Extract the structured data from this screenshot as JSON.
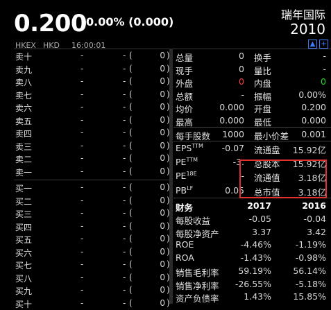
{
  "quote": {
    "price": "0.200",
    "change": "0.00% (0.000)",
    "stock_name": "瑞年国际",
    "stock_code": "2010",
    "exchange": "HKEX",
    "currency": "HKD",
    "time": "16:00:01"
  },
  "icons": {
    "flag_icon": "flag-icon",
    "add_icon": "plus-icon"
  },
  "order_book": {
    "sell": [
      {
        "label": "卖十",
        "price": "-",
        "dash": "-",
        "paren": "(",
        "qty": "0",
        "close": ")"
      },
      {
        "label": "卖九",
        "price": "-",
        "dash": "-",
        "paren": "(",
        "qty": "0",
        "close": ")"
      },
      {
        "label": "卖八",
        "price": "-",
        "dash": "-",
        "paren": "(",
        "qty": "0",
        "close": ")"
      },
      {
        "label": "卖七",
        "price": "-",
        "dash": "-",
        "paren": "(",
        "qty": "0",
        "close": ")"
      },
      {
        "label": "卖六",
        "price": "-",
        "dash": "-",
        "paren": "(",
        "qty": "0",
        "close": ")"
      },
      {
        "label": "卖五",
        "price": "-",
        "dash": "-",
        "paren": "(",
        "qty": "0",
        "close": ")"
      },
      {
        "label": "卖四",
        "price": "-",
        "dash": "-",
        "paren": "(",
        "qty": "0",
        "close": ")"
      },
      {
        "label": "卖三",
        "price": "-",
        "dash": "-",
        "paren": "(",
        "qty": "0",
        "close": ")"
      },
      {
        "label": "卖二",
        "price": "-",
        "dash": "-",
        "paren": "(",
        "qty": "0",
        "close": ")"
      },
      {
        "label": "卖一",
        "price": "-",
        "dash": "-",
        "paren": "(",
        "qty": "0",
        "close": ")"
      }
    ],
    "buy": [
      {
        "label": "买一",
        "price": "-",
        "dash": "-",
        "paren": "(",
        "qty": "0",
        "close": ")"
      },
      {
        "label": "买二",
        "price": "-",
        "dash": "-",
        "paren": "(",
        "qty": "0",
        "close": ")"
      },
      {
        "label": "买三",
        "price": "-",
        "dash": "-",
        "paren": "(",
        "qty": "0",
        "close": ")"
      },
      {
        "label": "买四",
        "price": "-",
        "dash": "-",
        "paren": "(",
        "qty": "0",
        "close": ")"
      },
      {
        "label": "买五",
        "price": "-",
        "dash": "-",
        "paren": "(",
        "qty": "0",
        "close": ")"
      },
      {
        "label": "买六",
        "price": "-",
        "dash": "-",
        "paren": "(",
        "qty": "0",
        "close": ")"
      },
      {
        "label": "买七",
        "price": "-",
        "dash": "-",
        "paren": "(",
        "qty": "0",
        "close": ")"
      },
      {
        "label": "买八",
        "price": "-",
        "dash": "-",
        "paren": "(",
        "qty": "0",
        "close": ")"
      },
      {
        "label": "买九",
        "price": "-",
        "dash": "-",
        "paren": "(",
        "qty": "0",
        "close": ")"
      },
      {
        "label": "买十",
        "price": "-",
        "dash": "-",
        "paren": "(",
        "qty": "0",
        "close": ")"
      }
    ]
  },
  "stats": [
    {
      "l1": "总量",
      "v1": "0",
      "l2": "换手",
      "v2": "-"
    },
    {
      "l1": "现手",
      "v1": "0",
      "l2": "量比",
      "v2": "-"
    },
    {
      "l1": "外盘",
      "v1": "0",
      "l2": "内盘",
      "v2": "0"
    },
    {
      "l1": "总额",
      "v1": "-",
      "l2": "振幅",
      "v2": "0.00%"
    },
    {
      "l1": "均价",
      "v1": "0.000",
      "l2": "开盘",
      "v2": "0.200"
    },
    {
      "l1": "最高",
      "v1": "0.000",
      "l2": "最低",
      "v2": "0.000"
    }
  ],
  "lot": {
    "l1": "每手股数",
    "v1": "1000",
    "l2": "最小价差",
    "v2": "0.001"
  },
  "valuation": [
    {
      "l1": "EPS",
      "sup1": "TTM",
      "v1": "-0.07",
      "l2": "流通盘",
      "v2": "15.92亿"
    },
    {
      "l1": "PE",
      "sup1": "TTM",
      "v1": "-3.",
      "l2": "总股本",
      "v2": "15.92亿"
    },
    {
      "l1": "PE",
      "sup1": "18E",
      "v1": "-",
      "l2": "流通值",
      "v2": "3.18亿"
    },
    {
      "l1": "PB",
      "sup1": "LF",
      "v1": "0.05",
      "l2": "总市值",
      "v2": "3.18亿"
    }
  ],
  "financials": {
    "header": {
      "label": "财务",
      "y1": "2017",
      "y2": "2016"
    },
    "rows": [
      {
        "label": "每股收益",
        "y1": "-0.05",
        "y2": "-0.04"
      },
      {
        "label": "每股净资产",
        "y1": "3.37",
        "y2": "3.42"
      },
      {
        "label": "ROE",
        "y1": "-4.46%",
        "y2": "-1.19%"
      },
      {
        "label": "ROA",
        "y1": "-1.43%",
        "y2": "-0.98%"
      },
      {
        "label": "销售毛利率",
        "y1": "59.19%",
        "y2": "56.14%"
      },
      {
        "label": "销售净利率",
        "y1": "-26.55%",
        "y2": "-5.18%"
      },
      {
        "label": "资产负债率",
        "y1": "1.43%",
        "y2": "15.85%"
      }
    ]
  }
}
